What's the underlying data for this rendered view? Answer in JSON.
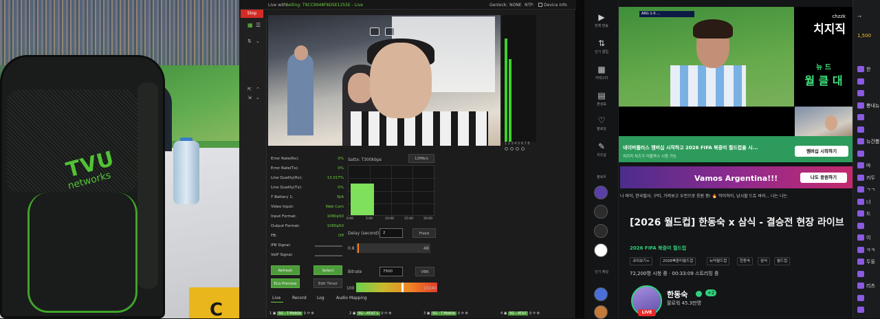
{
  "photo": {
    "logo_main": "TVU",
    "logo_sub": "networks",
    "sign_letter": "C"
  },
  "tvu": {
    "stop_label": "Stop",
    "top_bar": {
      "live_with": "Live with:",
      "device_id": "Selling: T9CC9948F8D5E1255E - Live",
      "genlock_label": "Genlock:",
      "genlock_value": "NONE",
      "ntp_label": "NTP:",
      "device_info": "Device Info"
    },
    "meter_label": "1 2 3 4 5 6 7 8",
    "stats": [
      {
        "label": "Error Rate(Rx):",
        "value": "0%"
      },
      {
        "label": "Error Rate(Tx):",
        "value": "0%"
      },
      {
        "label": "Line Quality(Rx):",
        "value": "13.01T%"
      },
      {
        "label": "Line Quality(Tx):",
        "value": "0%"
      },
      {
        "label": "T Battery 1:",
        "value": "N/A"
      },
      {
        "label": "Video Input:",
        "value": "Web Cam"
      },
      {
        "label": "Input Format:",
        "value": "1080p50"
      },
      {
        "label": "Output Format:",
        "value": "1080p50"
      },
      {
        "label": "FB:",
        "value": "Off"
      },
      {
        "label": "IFB Signal:",
        "value": ""
      },
      {
        "label": "VoIP Signal:",
        "value": ""
      }
    ],
    "chart_title": "Sattx: T300kbps",
    "chart_value_label": "12Mb/s",
    "chart_xticks": [
      "0:00",
      "5:00",
      "10:00",
      "15:00",
      "20:00"
    ],
    "delay_label": "Delay (second)",
    "delay_value": "2",
    "fixed_label": "Fixed",
    "slider1_min": "0.8",
    "slider1_max": "48",
    "bitrate_label": "Bitrate",
    "bitrate_value": "7500",
    "vbr_label": "VBR",
    "slider2_min": "100",
    "slider2_max": "10240",
    "buttons": {
      "refresh": "Refresh",
      "select": "Select",
      "eco_preview": "Eco-Preview",
      "edit_timer": "Edit Timer"
    },
    "tabs": [
      "Live",
      "Record",
      "Log",
      "Audio Mapping"
    ],
    "modules": [
      {
        "num": "1",
        "name": "5G - T-Mobile"
      },
      {
        "num": "2",
        "name": "5G - AT&T L"
      },
      {
        "num": "3",
        "name": "5G - T-Mobile"
      },
      {
        "num": "4",
        "name": "5G - AT&T"
      }
    ]
  },
  "chzzk": {
    "nav": [
      {
        "icon": "▶",
        "label": "전체 방송"
      },
      {
        "icon": "⇅",
        "label": "인기 클립"
      },
      {
        "icon": "▦",
        "label": "카테고리"
      },
      {
        "icon": "▤",
        "label": "편성표"
      },
      {
        "icon": "♡",
        "label": "팔로잉"
      },
      {
        "icon": "✎",
        "label": "치즈샵"
      }
    ],
    "nav_following_label": "팔로우",
    "nav_rec_label": "인기 채널",
    "player": {
      "logo_small": "chzzk",
      "logo_big": "치지직",
      "event_l1": "뉴 드",
      "event_l2": "월 클 대",
      "scoreboard": "ARG 1-0 ..."
    },
    "ad": {
      "text": "네이버플러스 멤버십 시작하고 2026 FIFA 북중미 월드컵을 시...",
      "sub": "치지직 치즈가 미블루스 시청 가능",
      "button": "멤버십 시작하기"
    },
    "banner": {
      "text": "Vamos Argentina!!!",
      "button": "나도 응원하기"
    },
    "ticker": "나 바이, 한국필사, 구미, 가려보고 우전으로 응원 중! 🔥 막이하이, 남시할 드듀 바라... 나는 나는",
    "title": "[2026 월드컵] 한동숙 x 삼식 - 결승전 현장 라이브",
    "category": "2026 FIFA 북중미 월드컵",
    "tags": [
      "코이보기+",
      "2026북중미월드컵",
      "뉴덕월드컵",
      "한동숙",
      "삼식",
      "월드컵"
    ],
    "stats": "72,200명 시청 중 · 00:33:09 스트리밍 중",
    "channel": {
      "name": "한동숙",
      "plus": "+2",
      "followers": "팔로워 45.3만명",
      "live": "LIVE"
    },
    "chat": {
      "cheese": "1,500",
      "lines": [
        "한",
        "",
        "",
        "뽕내뉴",
        "",
        "",
        "뉴간뽑",
        "",
        "마",
        "키두",
        "ㄱㄱ",
        "너",
        "드",
        "",
        "이",
        "ㅋㅋ",
        "두둥",
        "",
        "리츠",
        "",
        ""
      ]
    },
    "chat_top_icon": "→"
  }
}
